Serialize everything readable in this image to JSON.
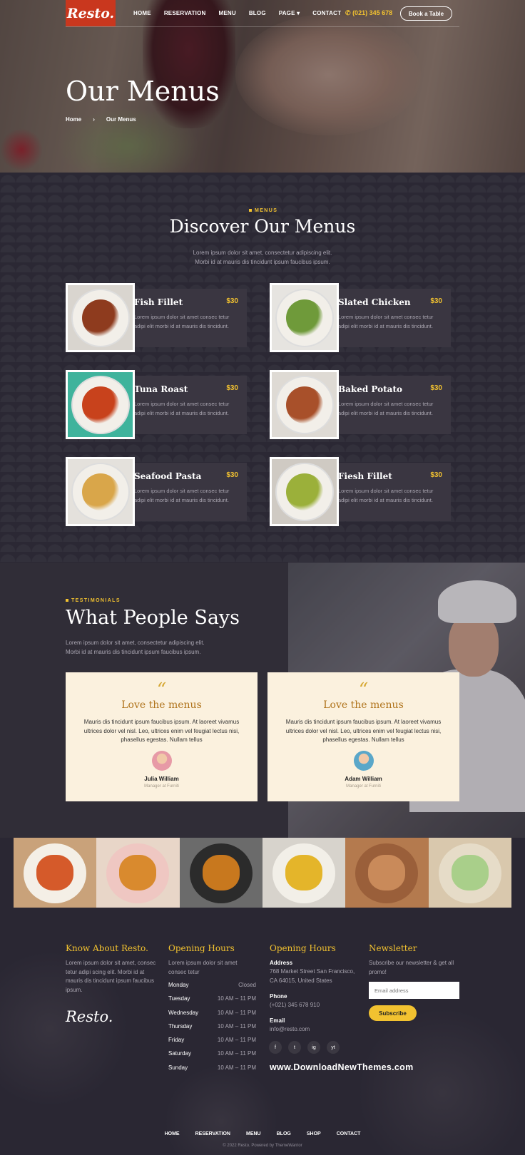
{
  "header": {
    "logo": "Resto.",
    "nav": [
      "HOME",
      "RESERVATION",
      "MENU",
      "BLOG",
      "PAGE",
      "CONTACT"
    ],
    "phone": "(021) 345 678",
    "book_label": "Book a Table"
  },
  "hero": {
    "title": "Our Menus",
    "breadcrumb": {
      "home": "Home",
      "sep": "›",
      "current": "Our Menus"
    }
  },
  "menus": {
    "kicker": "MENUS",
    "title": "Discover Our Menus",
    "subtitle_1": "Lorem ipsum dolor sit amet, consectetur adipiscing elit.",
    "subtitle_2": "Morbi id at mauris dis tincidunt ipsum faucibus ipsum.",
    "items": [
      {
        "name": "Fish Fillet",
        "price": "$30",
        "desc": "Lorem ipsum dolor sit amet consec tetur adipi elit morbi id at mauris dis tincidunt.",
        "food_color": "#8e3b1e",
        "bg": "#d9d5cf"
      },
      {
        "name": "Slated Chicken",
        "price": "$30",
        "desc": "Lorem ipsum dolor sit amet consec tetur adipi elit morbi id at mauris dis tincidunt.",
        "food_color": "#6f9a3a",
        "bg": "#e6e4e0"
      },
      {
        "name": "Tuna Roast",
        "price": "$30",
        "desc": "Lorem ipsum dolor sit amet consec tetur adipi elit morbi id at mauris dis tincidunt.",
        "food_color": "#c8421c",
        "bg": "#3fb39c"
      },
      {
        "name": "Baked Potato",
        "price": "$30",
        "desc": "Lorem ipsum dolor sit amet consec tetur adipi elit morbi id at mauris dis tincidunt.",
        "food_color": "#a8502a",
        "bg": "#dedad4"
      },
      {
        "name": "Seafood Pasta",
        "price": "$30",
        "desc": "Lorem ipsum dolor sit amet consec tetur adipi elit morbi id at mauris dis tincidunt.",
        "food_color": "#d9a64a",
        "bg": "#e4e1dc"
      },
      {
        "name": "Fiesh Fillet",
        "price": "$30",
        "desc": "Lorem ipsum dolor sit amet consec tetur adipi elit morbi id at mauris dis tincidunt.",
        "food_color": "#9bb03a",
        "bg": "#cfcac3"
      }
    ]
  },
  "testimonials": {
    "kicker": "TESTIMONIALS",
    "title": "What People Says",
    "subtitle_1": "Lorem ipsum dolor sit amet, consectetur adipiscing elit.",
    "subtitle_2": "Morbi id at mauris dis tincidunt ipsum faucibus ipsum.",
    "cards": [
      {
        "quote": "“",
        "title": "Love the menus",
        "text": "Mauris dis tincidunt ipsum faucibus ipsum. At laoreet vivamus ultrices dolor vel nisl. Leo, ultrices enim vel feugiat lectus nisi, phasellus egestas. Nullam tellus",
        "name": "Julia William",
        "role": "Manager at Furniti",
        "avatar_color": "#e79aa6"
      },
      {
        "quote": "“",
        "title": "Love the menus",
        "text": "Mauris dis tincidunt ipsum faucibus ipsum. At laoreet vivamus ultrices dolor vel nisl. Leo, ultrices enim vel feugiat lectus nisi, phasellus egestas. Nullam tellus",
        "name": "Adam William",
        "role": "Manager at Furniti",
        "avatar_color": "#5aa7c9"
      }
    ]
  },
  "gallery": [
    {
      "bg": "#c9a27a",
      "plate": "#f4efe6",
      "food": "#d55a2a"
    },
    {
      "bg": "#e8d6c8",
      "plate": "#efc7c2",
      "food": "#d98a2e"
    },
    {
      "bg": "#6b6b6b",
      "plate": "#2b2b2b",
      "food": "#c8781e"
    },
    {
      "bg": "#d7d3cc",
      "plate": "#f2efe8",
      "food": "#e4b52a"
    },
    {
      "bg": "#b47a4e",
      "plate": "#9a5f3a",
      "food": "#c98a5a"
    },
    {
      "bg": "#d9c8ad",
      "plate": "#e6dcc8",
      "food": "#a9cf8a"
    }
  ],
  "footer": {
    "about_title": "Know About Resto.",
    "about_text": "Lorem ipsum dolor sit amet, consec tetur adipi scing elit. Morbi id at mauris dis tincidunt ipsum faucibus ipsum.",
    "logo": "Resto.",
    "hours_title": "Opening Hours",
    "hours_text": "Lorem ipsum dolor sit amet consec tetur",
    "hours": [
      {
        "day": "Monday",
        "time": "Closed"
      },
      {
        "day": "Tuesday",
        "time": "10 AM – 11 PM"
      },
      {
        "day": "Wednesday",
        "time": "10 AM – 11 PM"
      },
      {
        "day": "Thursday",
        "time": "10 AM – 11 PM"
      },
      {
        "day": "Friday",
        "time": "10 AM – 11 PM"
      },
      {
        "day": "Saturday",
        "time": "10 AM – 11 PM"
      },
      {
        "day": "Sunday",
        "time": "10 AM – 11 PM"
      }
    ],
    "contact_title": "Opening Hours",
    "address_label": "Address",
    "address_1": "768 Market Street San Francisco,",
    "address_2": "CA 64015, United States",
    "phone_label": "Phone",
    "phone": "(+021) 345 678 910",
    "email_label": "Email",
    "email": "info@resto.com",
    "social": [
      "f",
      "t",
      "ig",
      "yt"
    ],
    "watermark": "www.DownloadNewThemes.com",
    "newsletter_title": "Newsletter",
    "newsletter_text": "Subscribe our newsletter & get all promo!",
    "email_placeholder": "Email address",
    "subscribe_label": "Subscribe",
    "nav": [
      "HOME",
      "RESERVATION",
      "MENU",
      "BLOG",
      "SHOP",
      "CONTACT"
    ],
    "copyright": "© 2022 Resto. Powered by ThemeWarrior"
  }
}
